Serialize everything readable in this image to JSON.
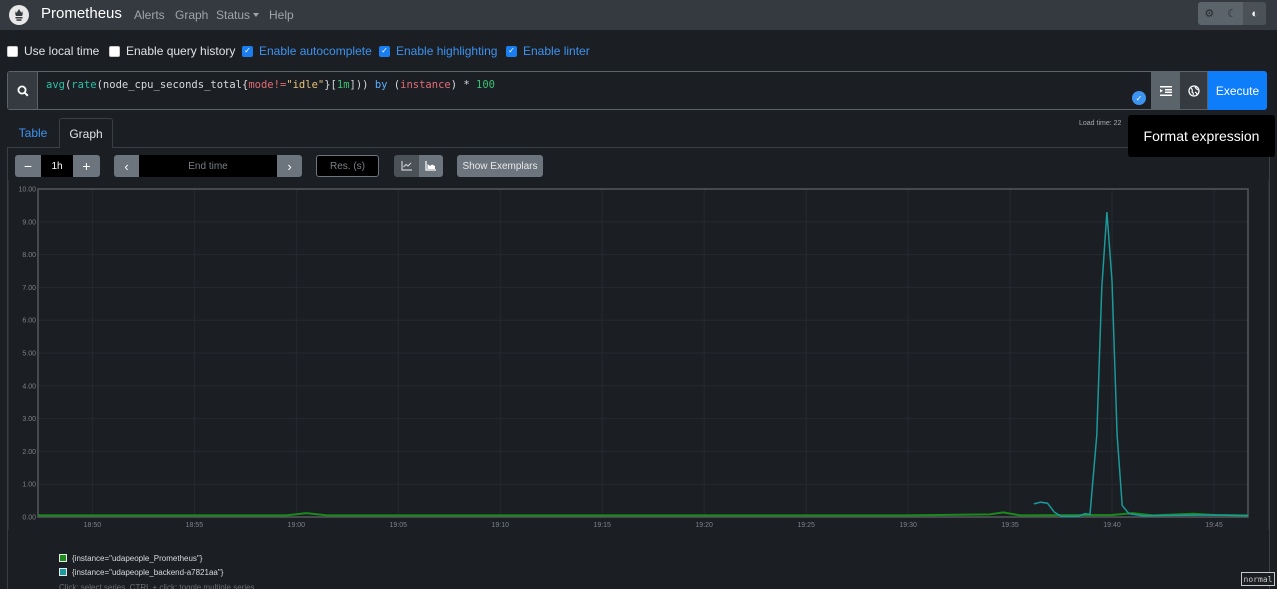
{
  "navbar": {
    "brand": "Prometheus",
    "links": [
      {
        "label": "Alerts"
      },
      {
        "label": "Graph"
      },
      {
        "label": "Status"
      },
      {
        "label": "Help"
      }
    ],
    "theme_buttons": [
      {
        "icon": "gear-icon",
        "glyph": "⚙",
        "active": false
      },
      {
        "icon": "moon-icon",
        "glyph": "☾",
        "active": false
      },
      {
        "icon": "adjust-icon",
        "glyph": "◐",
        "active": true
      }
    ]
  },
  "options": [
    {
      "label": "Use local time",
      "checked": false
    },
    {
      "label": "Enable query history",
      "checked": false
    },
    {
      "label": "Enable autocomplete",
      "checked": true
    },
    {
      "label": "Enable highlighting",
      "checked": true
    },
    {
      "label": "Enable linter",
      "checked": true
    }
  ],
  "expression": {
    "tokens": [
      {
        "t": "avg",
        "c": "tk-fn"
      },
      {
        "t": "(",
        "c": "tk-metric"
      },
      {
        "t": "rate",
        "c": "tk-fn"
      },
      {
        "t": "(",
        "c": "tk-metric"
      },
      {
        "t": "node_cpu_seconds_total",
        "c": "tk-metric"
      },
      {
        "t": "{",
        "c": "tk-metric"
      },
      {
        "t": "mode",
        "c": "tk-label"
      },
      {
        "t": "!=",
        "c": "tk-label"
      },
      {
        "t": "\"idle\"",
        "c": "tk-str"
      },
      {
        "t": "}[",
        "c": "tk-metric"
      },
      {
        "t": "1m",
        "c": "tk-dur"
      },
      {
        "t": "])) ",
        "c": "tk-metric"
      },
      {
        "t": "by",
        "c": "tk-kw"
      },
      {
        "t": " (",
        "c": "tk-metric"
      },
      {
        "t": "instance",
        "c": "tk-label"
      },
      {
        "t": ") * ",
        "c": "tk-metric"
      },
      {
        "t": "100",
        "c": "tk-num"
      }
    ],
    "execute_label": "Execute",
    "format_tooltip": "Format expression"
  },
  "tabs": {
    "table": "Table",
    "graph": "Graph",
    "active": "graph"
  },
  "load_time": "Load time: 22",
  "controls": {
    "range_minus": "−",
    "range_value": "1h",
    "range_plus": "+",
    "end_time_placeholder": "End time",
    "prev": "‹",
    "next": "›",
    "resolution_placeholder": "Res. (s)",
    "show_exemplars": "Show Exemplars"
  },
  "chart_data": {
    "type": "line",
    "title": "",
    "xlabel": "",
    "ylabel": "",
    "ylim": [
      0,
      10
    ],
    "xlim": [
      "18:47:20",
      "19:46:40"
    ],
    "x_ticks": [
      "18:50",
      "18:55",
      "19:00",
      "19:05",
      "19:10",
      "19:15",
      "19:20",
      "19:25",
      "19:30",
      "19:35",
      "19:40",
      "19:45"
    ],
    "y_ticks": [
      "0.00",
      "1.00",
      "2.00",
      "3.00",
      "4.00",
      "5.00",
      "6.00",
      "7.00",
      "8.00",
      "9.00",
      "10.00"
    ],
    "grid": true,
    "series": [
      {
        "name": "{instance=\"udapeople_Prometheus\"}",
        "color": "#1a8a1a",
        "points": [
          [
            "18:47:20",
            0.05
          ],
          [
            "18:55:00",
            0.05
          ],
          [
            "18:59:30",
            0.05
          ],
          [
            "19:00:30",
            0.12
          ],
          [
            "19:01:30",
            0.05
          ],
          [
            "19:10:00",
            0.05
          ],
          [
            "19:20:00",
            0.05
          ],
          [
            "19:30:00",
            0.05
          ],
          [
            "19:34:00",
            0.08
          ],
          [
            "19:34:40",
            0.14
          ],
          [
            "19:35:30",
            0.05
          ],
          [
            "19:40:00",
            0.06
          ],
          [
            "19:41:00",
            0.12
          ],
          [
            "19:42:00",
            0.05
          ],
          [
            "19:44:00",
            0.1
          ],
          [
            "19:45:00",
            0.06
          ],
          [
            "19:46:40",
            0.05
          ]
        ]
      },
      {
        "name": "{instance=\"udapeople_backend-a7821aa\"}",
        "color": "#1a9a9a",
        "points": [
          [
            "19:36:10",
            0.4
          ],
          [
            "19:36:30",
            0.45
          ],
          [
            "19:36:50",
            0.42
          ],
          [
            "19:37:10",
            0.15
          ],
          [
            "19:37:30",
            0.02
          ],
          [
            "19:38:20",
            0.02
          ],
          [
            "19:38:40",
            0.1
          ],
          [
            "19:38:55",
            0.08
          ],
          [
            "19:39:15",
            2.5
          ],
          [
            "19:39:30",
            7.0
          ],
          [
            "19:39:45",
            9.3
          ],
          [
            "19:40:00",
            7.2
          ],
          [
            "19:40:15",
            2.5
          ],
          [
            "19:40:30",
            0.35
          ],
          [
            "19:40:50",
            0.1
          ],
          [
            "19:41:30",
            0.04
          ],
          [
            "19:43:00",
            0.05
          ],
          [
            "19:45:00",
            0.06
          ],
          [
            "19:46:40",
            0.04
          ]
        ]
      }
    ],
    "legend_position": "bottom-left"
  },
  "legend_hint": "Click: select series, CTRL + click: toggle multiple series",
  "mode_indicator": "normal"
}
